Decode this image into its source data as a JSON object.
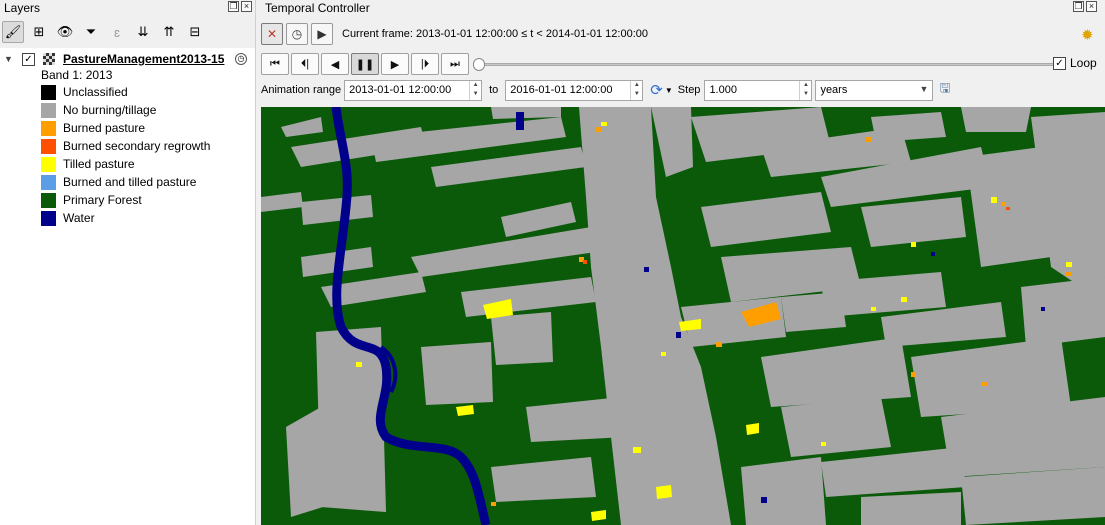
{
  "layers_panel": {
    "title": "Layers",
    "layer": {
      "name": "PastureManagement2013-15",
      "checked": true,
      "band_label": "Band 1: 2013",
      "legend": [
        {
          "label": "Unclassified",
          "color": "#000000"
        },
        {
          "label": "No burning/tillage",
          "color": "#a6a6a6"
        },
        {
          "label": "Burned pasture",
          "color": "#ff9e00"
        },
        {
          "label": "Burned secondary regrowth",
          "color": "#ff4f00"
        },
        {
          "label": "Tilled pasture",
          "color": "#ffff00"
        },
        {
          "label": "Burned and tilled pasture",
          "color": "#5b9ee6"
        },
        {
          "label": "Primary Forest",
          "color": "#0a5a0a"
        },
        {
          "label": "Water",
          "color": "#00008b"
        }
      ]
    }
  },
  "temporal": {
    "title": "Temporal Controller",
    "current_frame": "Current frame: 2013-01-01 12:00:00 ≤ t < 2014-01-01 12:00:00",
    "loop_label": "Loop",
    "loop_checked": true,
    "range_label": "Animation range",
    "range_from": "2013-01-01 12:00:00",
    "to_label": "to",
    "range_to": "2016-01-01 12:00:00",
    "step_label": "Step",
    "step_value": "1.000",
    "step_unit": "years",
    "slider_fraction": 0.0
  },
  "colors": {
    "forest": "#0a5a0a",
    "pasture": "#a6a6a6",
    "water": "#00008b",
    "tilled": "#ffff00",
    "burned": "#ff9e00"
  }
}
